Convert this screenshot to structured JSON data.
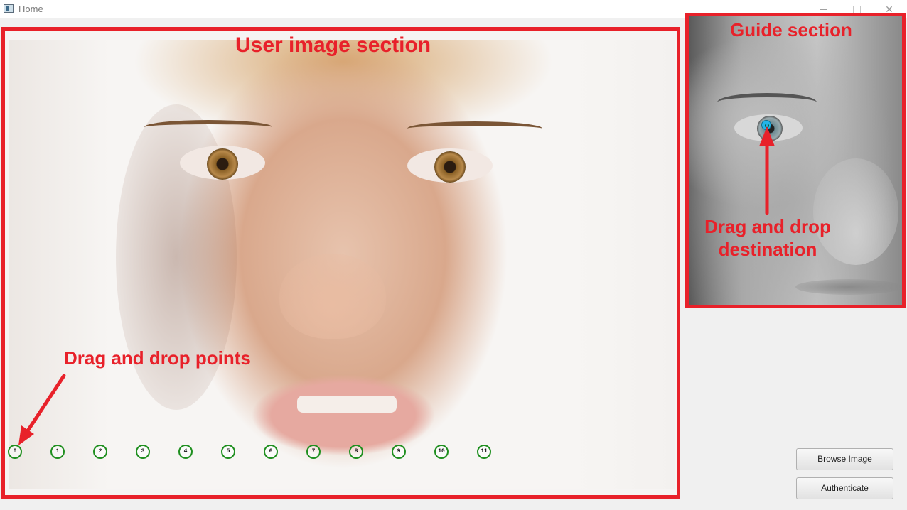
{
  "window": {
    "title": "Home",
    "icon": "app-window-icon"
  },
  "user_section": {
    "label": "User image section",
    "points_label": "Drag and drop points",
    "points": [
      "0",
      "1",
      "2",
      "3",
      "4",
      "5",
      "6",
      "7",
      "8",
      "9",
      "10",
      "11"
    ]
  },
  "guide_section": {
    "label": "Guide section",
    "destination_label": "Drag and drop destination"
  },
  "buttons": {
    "browse": "Browse Image",
    "authenticate": "Authenticate"
  },
  "colors": {
    "annotation": "#e8212a",
    "point_ring": "#1f8f1f",
    "destination_marker": "#23b3e8"
  }
}
